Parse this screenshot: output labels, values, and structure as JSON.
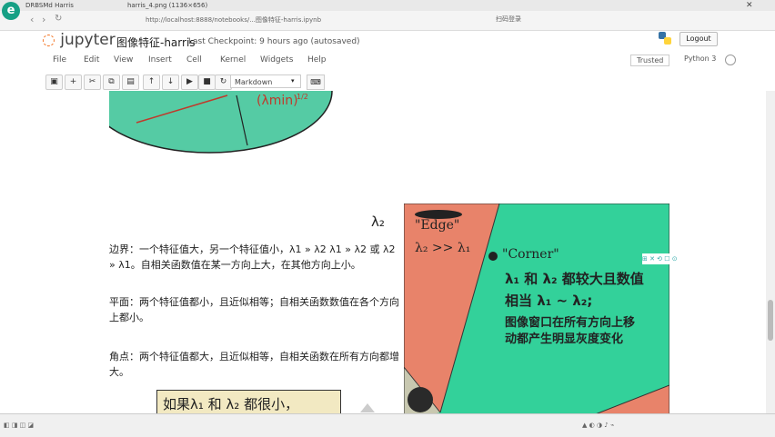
{
  "browser": {
    "tabs": [
      {
        "label": "DRBSMd Harris"
      },
      {
        "label": "harris_4.png (1136×656)"
      }
    ],
    "url": "http://localhost:8888/notebooks/...图像特征-harris.ipynb",
    "bookmark": "扫码登录"
  },
  "jupyter": {
    "logo": "jupyter",
    "title": "图像特征-harris",
    "checkpoint": "Last Checkpoint: 9 hours ago (autosaved)",
    "logout": "Logout",
    "menu": [
      "File",
      "Edit",
      "View",
      "Insert",
      "Cell",
      "Kernel",
      "Widgets",
      "Help"
    ],
    "trusted": "Trusted",
    "kernel": "Python 3",
    "cell_type": "Markdown"
  },
  "notes": {
    "edge": "边界：一个特征值大，另一个特征值小，λ1 » λ2 λ1 » λ2 或 λ2 » λ1。自相关函数值在某一方向上大，在其他方向上小。",
    "flat": "平面：两个特征值都小，且近似相等；自相关函数数值在各个方向上都小。",
    "corner": "角点：两个特征值都大，且近似相等，自相关函数在所有方向都增大。",
    "bottom_box": "如果λ₁ 和 λ₂ 都很小，"
  },
  "figure": {
    "lambda_min": "(λmin)",
    "exp": "1/2",
    "lambda2_axis": "λ₂",
    "edge_label": "\"Edge\"",
    "edge_cond": "λ₂ >> λ₁",
    "corner_label": "\"Corner\"",
    "corner_line1": "λ₁ 和 λ₂ 都较大且数值",
    "corner_line2": "相当 λ₁ ~ λ₂;",
    "corner_line3": "图像窗口在所有方向上移",
    "corner_line4": "动都产生明显灰度变化"
  },
  "colors": {
    "salmon": "#e8836a",
    "green": "#33d19a",
    "ellipse": "#55cba4"
  }
}
